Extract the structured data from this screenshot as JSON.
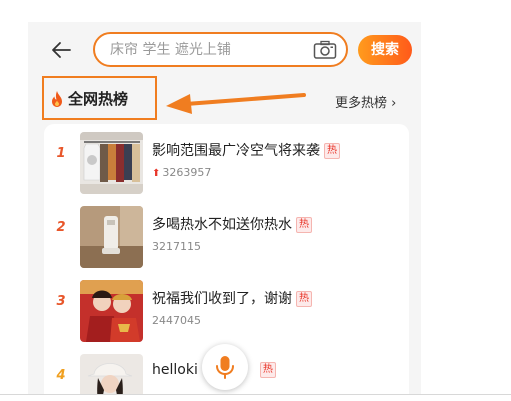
{
  "search": {
    "placeholder": "床帘 学生 遮光上铺",
    "button_label": "搜索"
  },
  "hot_list": {
    "title": "全网热榜",
    "more_label": "更多热榜",
    "tag_label": "热",
    "items": [
      {
        "rank": "1",
        "title": "影响范围最广冷空气将来袭",
        "count": "3263957",
        "trending_up": true
      },
      {
        "rank": "2",
        "title": "多喝热水不如送你热水",
        "count": "3217115"
      },
      {
        "rank": "3",
        "title": "祝福我们收到了，谢谢",
        "count": "2447045"
      },
      {
        "rank": "4",
        "title": "helloki"
      }
    ]
  },
  "icons": {
    "back": "arrow-left-icon",
    "camera": "camera-icon",
    "flame": "flame-icon",
    "mic": "microphone-icon",
    "up": "arrow-up-icon"
  },
  "colors": {
    "accent": "#f07d20",
    "search_button": "#ff6a1a",
    "rank_red": "#e8562a",
    "rank_gold": "#f0a020",
    "hot_tag": "#e8362a"
  }
}
